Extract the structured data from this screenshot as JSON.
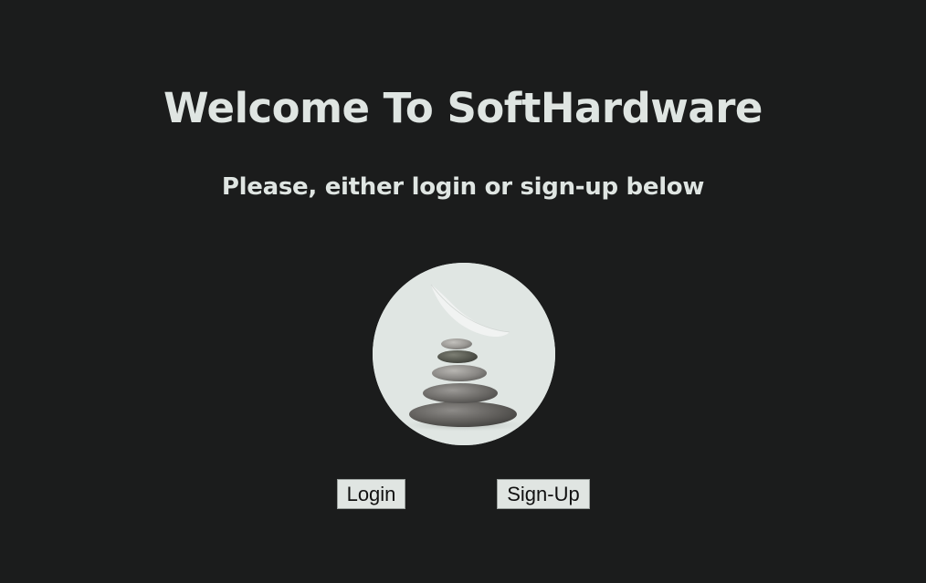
{
  "page": {
    "title": "Welcome To SoftHardware",
    "subtitle": "Please, either login or sign-up below"
  },
  "hero_image": {
    "icon": "stacked-stones-with-feather",
    "background_color": "#e0e6e3"
  },
  "buttons": {
    "login_label": "Login",
    "signup_label": "Sign-Up"
  },
  "colors": {
    "background": "#1b1c1c",
    "text": "#dfe5e2",
    "button_background": "#e0e5e2"
  }
}
